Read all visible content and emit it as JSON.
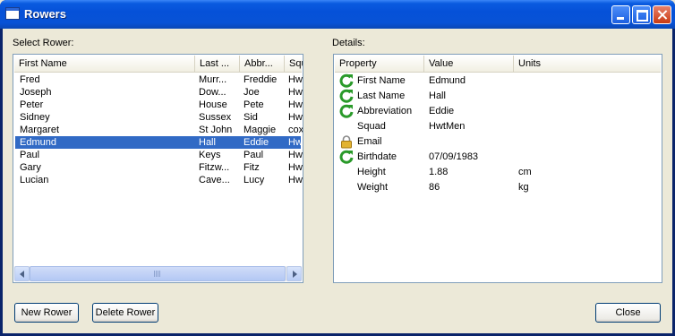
{
  "window": {
    "title": "Rowers"
  },
  "left_panel": {
    "label": "Select Rower:",
    "columns": [
      "First Name",
      "Last ...",
      "Abbr...",
      "Squ"
    ],
    "rows": [
      [
        "Fred",
        "Murr...",
        "Freddie",
        "Hw"
      ],
      [
        "Joseph",
        "Dow...",
        "Joe",
        "Hw"
      ],
      [
        "Peter",
        "House",
        "Pete",
        "Hw"
      ],
      [
        "Sidney",
        "Sussex",
        "Sid",
        "Hw"
      ],
      [
        "Margaret",
        "St John",
        "Maggie",
        "cox"
      ],
      [
        "Edmund",
        "Hall",
        "Eddie",
        "Hw"
      ],
      [
        "Paul",
        "Keys",
        "Paul",
        "Hw"
      ],
      [
        "Gary",
        "Fitzw...",
        "Fitz",
        "Hw"
      ],
      [
        "Lucian",
        "Cave...",
        "Lucy",
        "Hw"
      ]
    ],
    "selected_index": 5
  },
  "right_panel": {
    "label": "Details:",
    "columns": [
      "Property",
      "Value",
      "Units"
    ],
    "rows": [
      {
        "icon": "refresh-icon",
        "property": "First Name",
        "value": "Edmund",
        "units": ""
      },
      {
        "icon": "refresh-icon",
        "property": "Last Name",
        "value": "Hall",
        "units": ""
      },
      {
        "icon": "refresh-icon",
        "property": "Abbreviation",
        "value": "Eddie",
        "units": ""
      },
      {
        "icon": "",
        "property": "Squad",
        "value": "HwtMen",
        "units": ""
      },
      {
        "icon": "lock-icon",
        "property": "Email",
        "value": "",
        "units": ""
      },
      {
        "icon": "refresh-icon",
        "property": "Birthdate",
        "value": "07/09/1983",
        "units": ""
      },
      {
        "icon": "",
        "property": "Height",
        "value": "1.88",
        "units": "cm"
      },
      {
        "icon": "",
        "property": "Weight",
        "value": "86",
        "units": "kg"
      }
    ]
  },
  "buttons": {
    "new_rower": "New Rower",
    "delete_rower": "Delete Rower",
    "close": "Close"
  },
  "colors": {
    "selection": "#316ac5",
    "titlebar": "#0551d8",
    "refresh_icon": "#2a9a2a",
    "lock_icon": "#d9a520"
  }
}
